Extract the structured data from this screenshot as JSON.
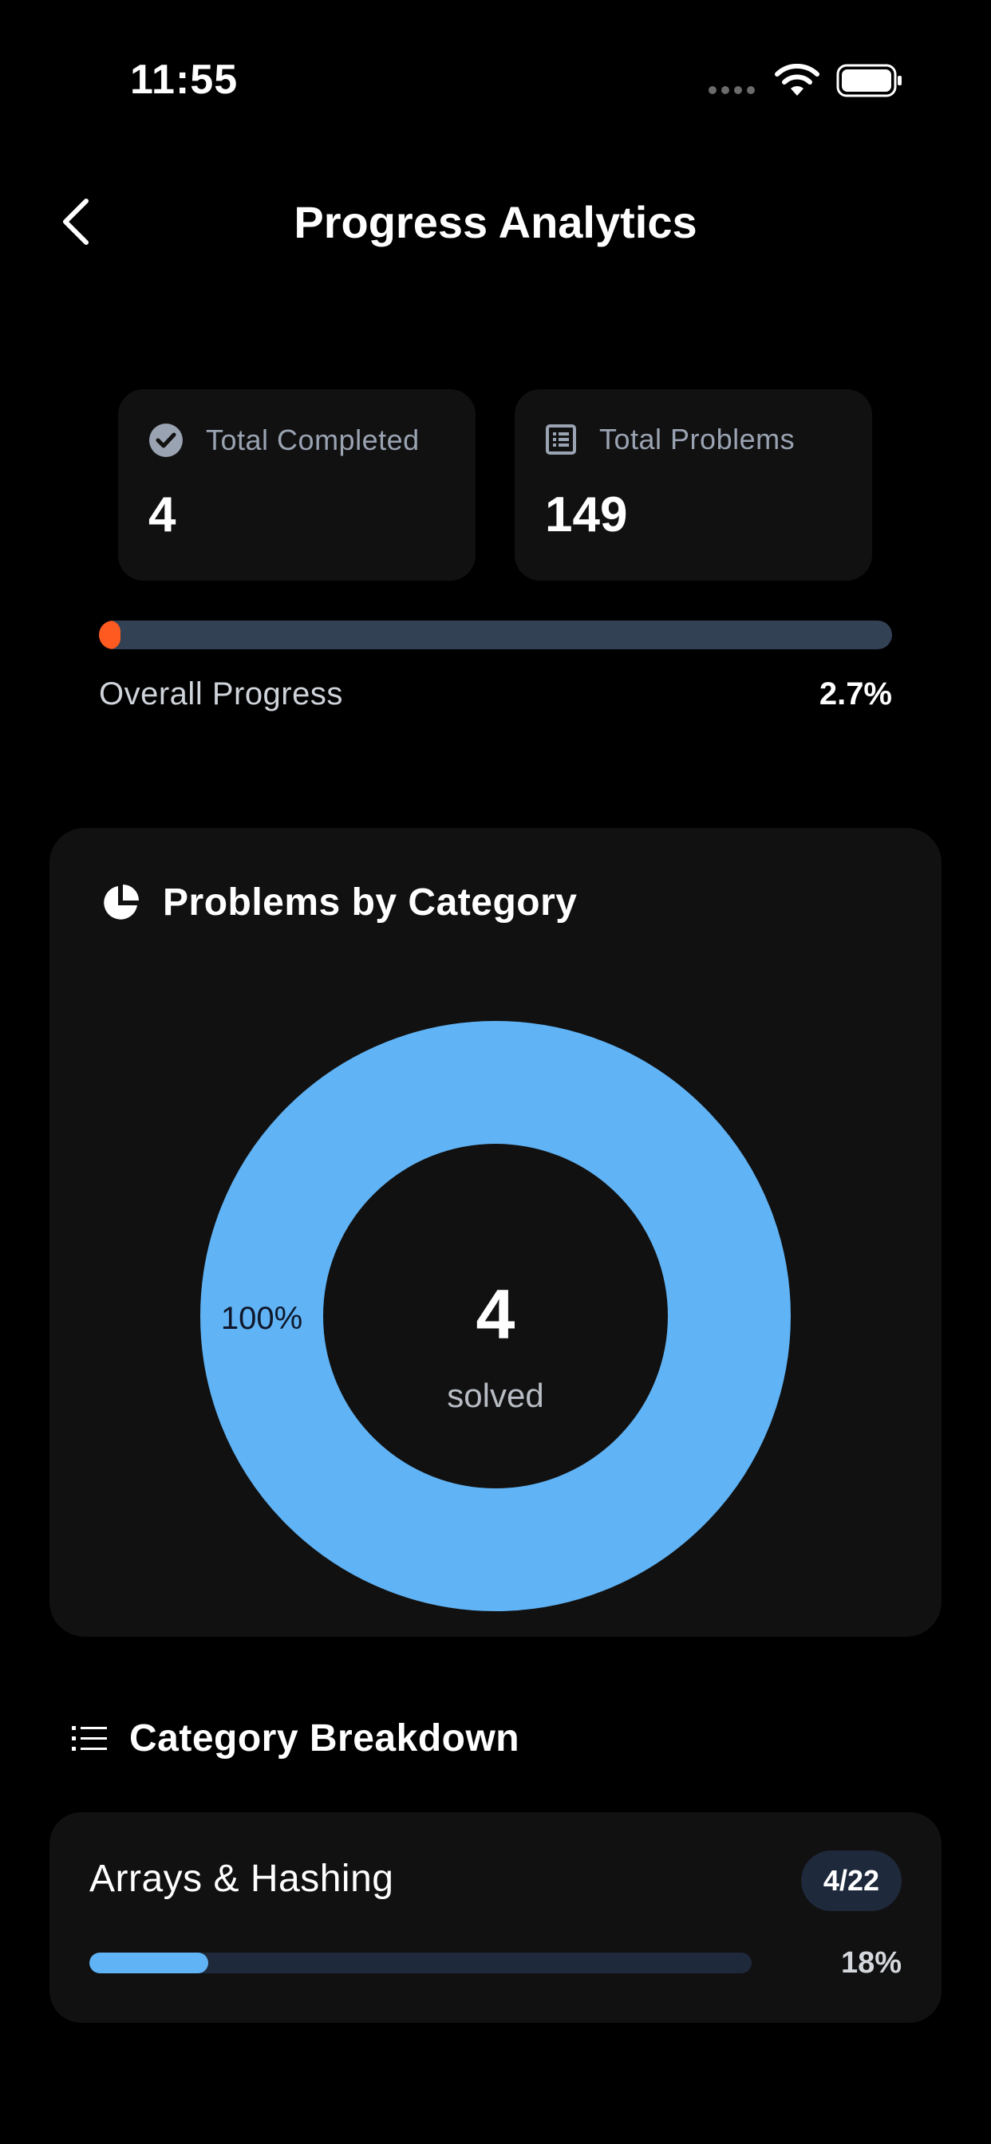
{
  "status_bar": {
    "time": "11:55"
  },
  "header": {
    "title": "Progress Analytics"
  },
  "stats": {
    "completed": {
      "label": "Total Completed",
      "value": "4"
    },
    "problems": {
      "label": "Total Problems",
      "value": "149"
    }
  },
  "overall": {
    "label": "Overall Progress",
    "percent_text": "2.7%",
    "fraction": 0.027,
    "color": "#ff5a1f"
  },
  "chart": {
    "title": "Problems by Category",
    "center_value": "4",
    "center_label": "solved",
    "slice_label": "100%"
  },
  "chart_data": {
    "type": "pie",
    "categories": [
      "Arrays & Hashing"
    ],
    "values": [
      4
    ],
    "slice_labels": [
      "100%"
    ],
    "colors": [
      "#60b3f5"
    ],
    "donut": true
  },
  "breakdown": {
    "title": "Category Breakdown",
    "items": [
      {
        "name": "Arrays & Hashing",
        "badge": "4/22",
        "percent_text": "18%",
        "fraction": 0.18,
        "color": "#60b3f5"
      }
    ]
  }
}
